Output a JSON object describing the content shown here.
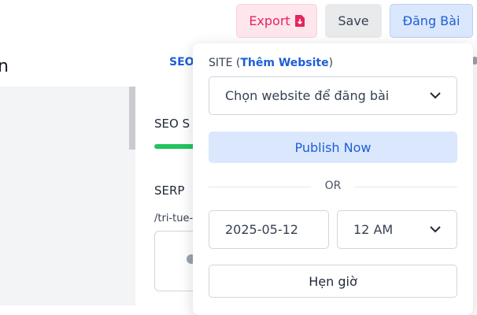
{
  "toolbar": {
    "export_label": "Export",
    "save_label": "Save",
    "publish_label": "Đăng Bài"
  },
  "background": {
    "title_fragment": "n",
    "tab_fragment": "SEO",
    "seo_label": "SEO S",
    "serp_label": "SERP",
    "slug_fragment": "/tri-tue-"
  },
  "popover": {
    "site_label": "SITE",
    "add_site_link": "Thêm Website",
    "site_select_placeholder": "Chọn website để đăng bài",
    "publish_now_label": "Publish Now",
    "or_text": "OR",
    "date_value": "2025-05-12",
    "time_value": "12 AM",
    "schedule_label": "Hẹn giờ"
  },
  "colors": {
    "accent_blue": "#1d5fd6",
    "export_pink": "#e5255e",
    "progress_green": "#22c55e"
  },
  "icons": {
    "export": "file-download-icon",
    "dropdown": "chevron-down-icon"
  }
}
